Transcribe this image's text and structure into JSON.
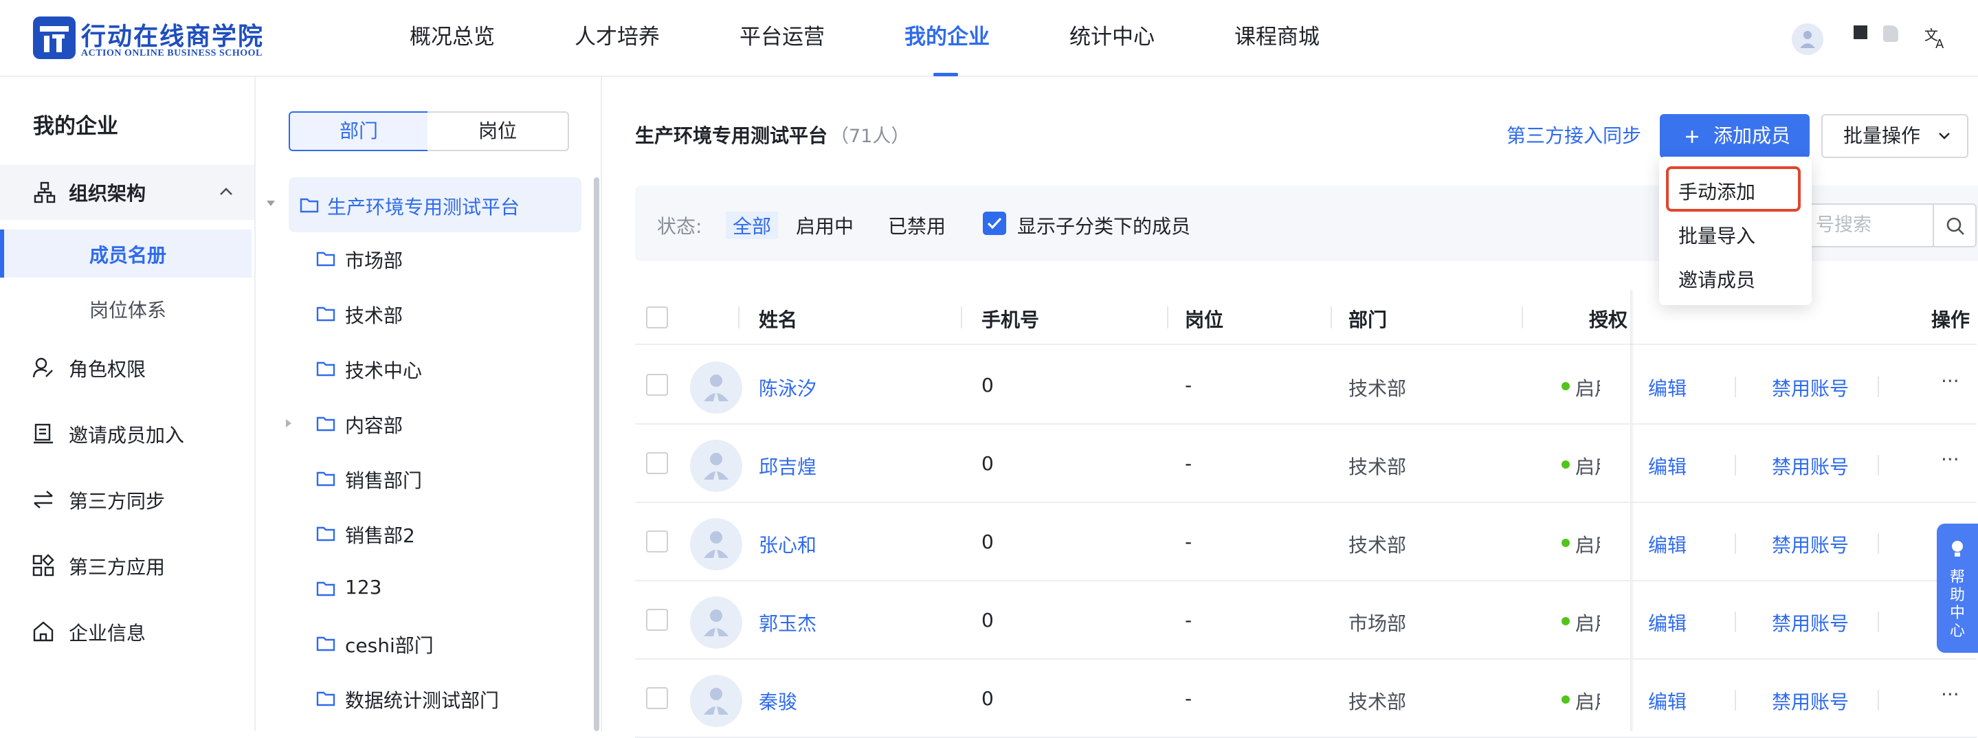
{
  "brand": {
    "name": "行动在线商学院",
    "subtitle": "ACTION ONLINE BUSINESS SCHOOL",
    "color": "#2f6bed"
  },
  "nav": [
    {
      "label": "概况总览",
      "active": false
    },
    {
      "label": "人才培养",
      "active": false
    },
    {
      "label": "平台运营",
      "active": false
    },
    {
      "label": "我的企业",
      "active": true
    },
    {
      "label": "统计中心",
      "active": false
    },
    {
      "label": "课程商城",
      "active": false
    }
  ],
  "sidebar": {
    "title": "我的企业",
    "items": [
      {
        "label": "组织架构",
        "icon": "org-chart-icon"
      },
      {
        "label": "成员名册",
        "active": true
      },
      {
        "label": "岗位体系"
      },
      {
        "label": "角色权限",
        "icon": "user-role-icon"
      },
      {
        "label": "邀请成员加入",
        "icon": "invite-icon"
      },
      {
        "label": "第三方同步",
        "icon": "sync-icon"
      },
      {
        "label": "第三方应用",
        "icon": "apps-icon"
      },
      {
        "label": "企业信息",
        "icon": "home-icon"
      }
    ]
  },
  "tree": {
    "tabs": [
      "部门",
      "岗位"
    ],
    "root": "生产环境专用测试平台",
    "children": [
      "市场部",
      "技术部",
      "技术中心",
      "内容部",
      "销售部门",
      "销售部2",
      "123",
      "ceshi部门",
      "数据统计测试部门"
    ]
  },
  "main": {
    "org_name": "生产环境专用测试平台",
    "count": "（71人）",
    "sync_link": "第三方接入同步",
    "add_button": "添加成员",
    "batch_button": "批量操作",
    "status_label": "状态:",
    "status_options": [
      "全部",
      "启用中",
      "已禁用"
    ],
    "show_sub_label": "显示子分类下的成员",
    "show_sub_checked": true,
    "search_placeholder": "号搜索"
  },
  "dropdown": [
    "手动添加",
    "批量导入",
    "邀请成员"
  ],
  "table": {
    "headers": [
      "姓名",
      "手机号",
      "岗位",
      "部门",
      "授权",
      "操作"
    ],
    "rows": [
      {
        "name": "陈泳汐",
        "phone": "0",
        "post": "-",
        "dept": "技术部",
        "status": "启用",
        "edit": "编辑",
        "disable": "禁用账号",
        "more": "···"
      },
      {
        "name": "邱吉煌",
        "phone": "0",
        "post": "-",
        "dept": "技术部",
        "status": "启用",
        "edit": "编辑",
        "disable": "禁用账号",
        "more": "···"
      },
      {
        "name": "张心和",
        "phone": "0",
        "post": "-",
        "dept": "技术部",
        "status": "启用",
        "edit": "编辑",
        "disable": "禁用账号",
        "more": "···"
      },
      {
        "name": "郭玉杰",
        "phone": "0",
        "post": "-",
        "dept": "市场部",
        "status": "启用",
        "edit": "编辑",
        "disable": "禁用账号",
        "more": "···"
      },
      {
        "name": "秦骏",
        "phone": "0",
        "post": "-",
        "dept": "技术部",
        "status": "启用",
        "edit": "编辑",
        "disable": "禁用账号",
        "more": "···"
      }
    ]
  },
  "help": {
    "label": "帮助中心"
  }
}
